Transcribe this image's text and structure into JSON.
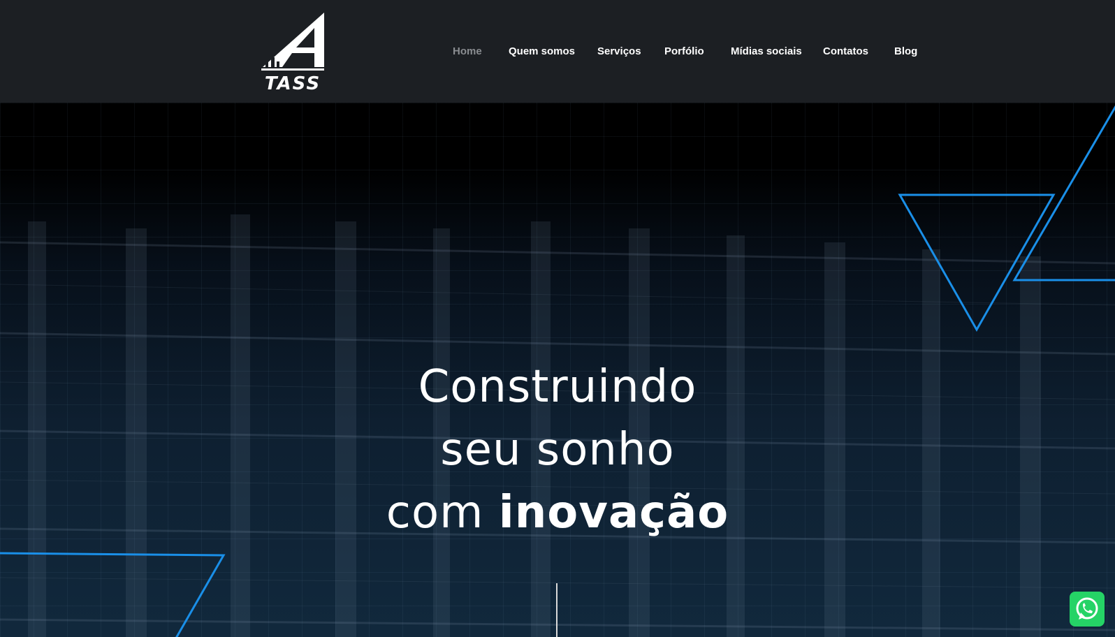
{
  "brand": {
    "logo_text": "TASS",
    "accent": "#1a8fe8",
    "header_bg": "#1c1f23"
  },
  "nav": {
    "items": [
      {
        "label": "Home",
        "active": true
      },
      {
        "label": "Quem somos"
      },
      {
        "label": "Serviços"
      },
      {
        "label": "Porfólio"
      },
      {
        "label": "Mídias sociais"
      },
      {
        "label": "Contatos"
      },
      {
        "label": "Blog"
      }
    ]
  },
  "hero": {
    "line1": "Construindo",
    "line2": "seu sonho",
    "line3_prefix": "com ",
    "line3_bold": "inovação"
  },
  "floating": {
    "whatsapp_icon": "whatsapp-icon",
    "whatsapp_color": "#25d366"
  }
}
